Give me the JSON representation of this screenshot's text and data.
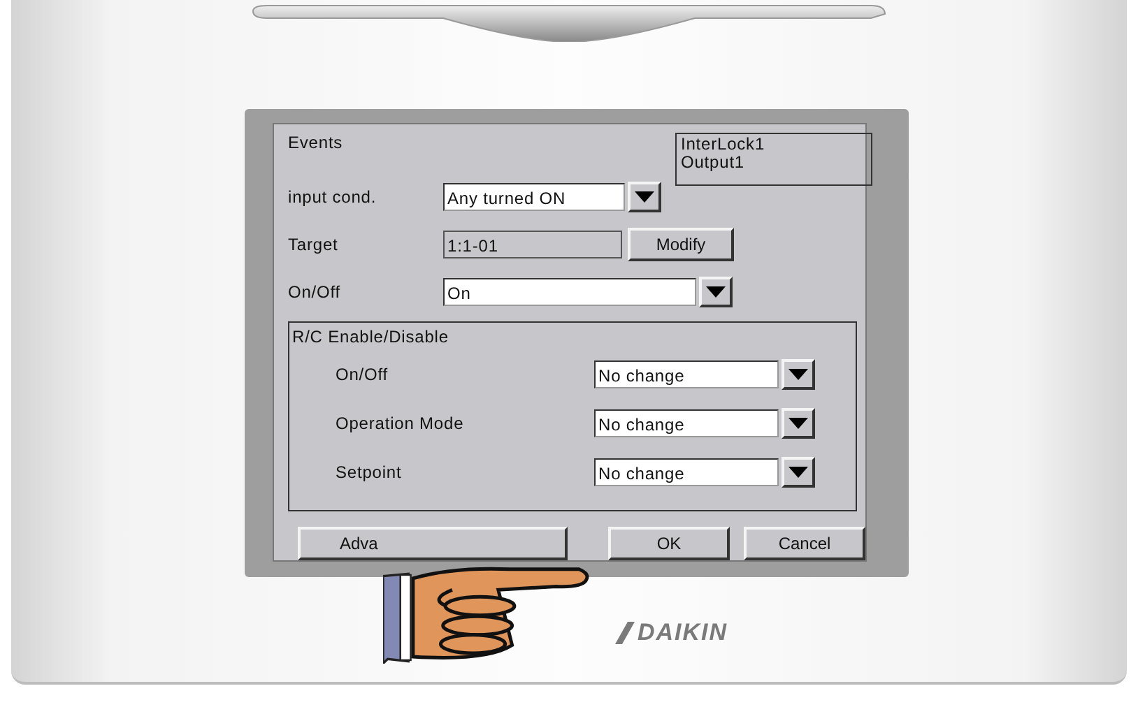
{
  "screen": {
    "title": "Events",
    "info_box": [
      "InterLock1",
      "Output1"
    ],
    "input_condition": {
      "label": "input cond.",
      "value": "Any turned ON"
    },
    "target": {
      "label": "Target",
      "value": "1:1-01",
      "button": "Modify"
    },
    "on_off": {
      "label": "On/Off",
      "value": "On"
    },
    "group": {
      "title": "R/C Enable/Disable",
      "rows": [
        {
          "label": "On/Off",
          "value": "No change"
        },
        {
          "label": "Operation Mode",
          "value": "No change"
        },
        {
          "label": "Setpoint",
          "value": "No change"
        }
      ]
    },
    "buttons": [
      "Adva",
      "OK",
      "Cancel"
    ]
  },
  "logo": "DAIKIN"
}
